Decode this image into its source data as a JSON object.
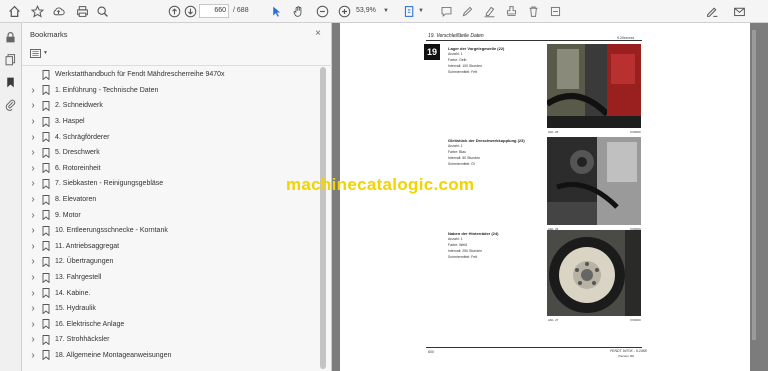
{
  "toolbar": {
    "current_page": "660",
    "page_separator": "/",
    "total_pages": "688",
    "zoom": "53,9%"
  },
  "bookmarks": {
    "title": "Bookmarks",
    "close_symbol": "×",
    "items": [
      {
        "label": "Werkstatthandbuch für Fendt Mähdrescherreihe 9470x",
        "expandable": false
      },
      {
        "label": "1. Einführung - Technische Daten",
        "expandable": true
      },
      {
        "label": "2. Schneidwerk",
        "expandable": true
      },
      {
        "label": "3. Haspel",
        "expandable": true
      },
      {
        "label": "4. Schrägförderer",
        "expandable": true
      },
      {
        "label": "5. Dreschwerk",
        "expandable": true
      },
      {
        "label": "6. Rotoreinheit",
        "expandable": true
      },
      {
        "label": "7. Siebkasten - Reinigungsgebläse",
        "expandable": true
      },
      {
        "label": "8. Elevatoren",
        "expandable": true
      },
      {
        "label": "9. Motor",
        "expandable": true
      },
      {
        "label": "10. Entleerungsschnecke - Korntank",
        "expandable": true
      },
      {
        "label": "11. Antriebsaggregat",
        "expandable": true
      },
      {
        "label": "12. Übertragungen",
        "expandable": true
      },
      {
        "label": "13. Fahrgestell",
        "expandable": true
      },
      {
        "label": "14. Kabine.",
        "expandable": true
      },
      {
        "label": "15. Hydraulik",
        "expandable": true
      },
      {
        "label": "16. Elektrische Anlage",
        "expandable": true
      },
      {
        "label": "17. Strohhäcksler",
        "expandable": true
      },
      {
        "label": "18. Allgemeine Montageanweisungen",
        "expandable": true
      }
    ]
  },
  "document": {
    "header": "19. Verschleißteile Daten",
    "header_right": "9.20xxxxxx",
    "chapter_number": "19",
    "items": [
      {
        "title": "Lager der Vorgelegewelle (22)",
        "lines": [
          "Anzahl: 1",
          "Farbe: Gelb",
          "Intervall: 100 Stunden",
          "Schmiermittel: Fett"
        ],
        "caption_left": "Abb. 25",
        "caption_right": "XX0000"
      },
      {
        "title": "Gleitstück der Dreschwerkkupplung (23)",
        "lines": [
          "Anzahl: 1",
          "Farbe: Blau",
          "Intervall: 50 Stunden",
          "Schmiermittel: Öl"
        ],
        "caption_left": "Abb. 26",
        "caption_right": "XX0000"
      },
      {
        "title": "Naben der Hinterräder (24)",
        "lines": [
          "Anzahl: 1",
          "Farbe: Weiß",
          "Intervall: 250 Stunden",
          "Schmiermittel: Fett"
        ],
        "caption_left": "Abb. 27",
        "caption_right": "XX0000"
      }
    ],
    "footer_left": "600",
    "footer_right": "FENDT 9470X - 9.2468",
    "footer_right2": "(Version 00)"
  },
  "watermark": "machinecatalogic.com",
  "colors": {
    "watermark": "#f2d400",
    "toolbar_bg": "#f5f5f5",
    "panel_bg": "#f7f7f7",
    "doc_bg": "#7c7c7c"
  },
  "icons": [
    "home-icon",
    "star-icon",
    "cloud-upload-icon",
    "print-icon",
    "zoom-search-icon",
    "page-up-icon",
    "page-down-icon",
    "cursor-icon",
    "hand-icon",
    "zoom-out-icon",
    "zoom-in-icon",
    "page-fit-icon",
    "comment-icon",
    "pen-icon",
    "highlight-icon",
    "stamp-icon",
    "delete-icon",
    "sign-icon",
    "email-icon",
    "lock-icon",
    "pages-icon",
    "bookmark-panel-icon",
    "attachment-icon"
  ]
}
